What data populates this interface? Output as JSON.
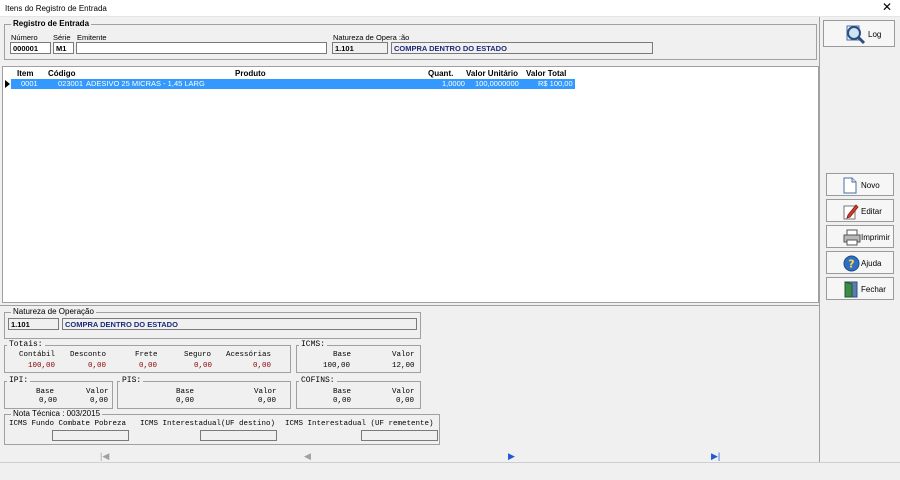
{
  "window": {
    "title": "Itens do Registro de Entrada",
    "close_glyph": "✕"
  },
  "registro": {
    "group_label": "Registro de Entrada",
    "numero_label": "Número",
    "numero_value": "000001",
    "serie_label": "Série",
    "serie_value": "M1",
    "emitente_label": "Emitente",
    "emitente_value": "",
    "natureza_label": "Natureza de Opera :ão",
    "natureza_code": "1.101",
    "natureza_desc": "COMPRA DENTRO DO ESTADO"
  },
  "grid": {
    "headers": [
      "Item",
      "Código",
      "Produto",
      "Quant.",
      "Valor Unitário",
      "Valor Total"
    ],
    "rows": [
      {
        "item": "0001",
        "codigo": "023001",
        "produto": "ADESIVO 25 MICRAS - 1,45 LARG",
        "quant": "1,0000",
        "valor_unitario": "100,0000000",
        "valor_total": "R$ 100,00"
      }
    ]
  },
  "natureza_operacao": {
    "label": "Natureza de Operação",
    "code": "1.101",
    "desc": "COMPRA DENTRO DO ESTADO"
  },
  "totais": {
    "label": "Totais:",
    "headers": [
      "Contábil",
      "Desconto",
      "Frete",
      "Seguro",
      "Acessórias"
    ],
    "values": [
      "100,00",
      "0,00",
      "0,00",
      "0,00",
      "0,00"
    ]
  },
  "icms": {
    "label": "ICMS:",
    "base_label": "Base",
    "valor_label": "Valor",
    "base": "100,00",
    "valor": "12,00"
  },
  "ipi": {
    "label": "IPI:",
    "base_label": "Base",
    "valor_label": "Valor",
    "base": "0,00",
    "valor": "0,00"
  },
  "pis": {
    "label": "PIS:",
    "base_label": "Base",
    "valor_label": "Valor",
    "base": "0,00",
    "valor": "0,00"
  },
  "cofins": {
    "label": "COFINS:",
    "base_label": "Base",
    "valor_label": "Valor",
    "base": "0,00",
    "valor": "0,00"
  },
  "nota_tecnica": {
    "label": "Nota Técnica : 003/2015",
    "fcp_label": "ICMS Fundo Combate Pobreza",
    "uf_destino_label": "ICMS Interestadual(UF destino)",
    "uf_remetente_label": "ICMS Interestadual (UF remetente)"
  },
  "buttons": {
    "log": "Log",
    "novo": "Novo",
    "editar": "Editar",
    "imprimir": "Imprimir",
    "ajuda": "Ajuda",
    "fechar": "Fechar"
  },
  "nav": {
    "first": "|◀",
    "prev": "◀",
    "next": "▶",
    "last": "▶|"
  },
  "colors": {
    "selection": "#3399ff",
    "natureza_text": "#1c2c7a",
    "totais_values": "#8b0000"
  }
}
